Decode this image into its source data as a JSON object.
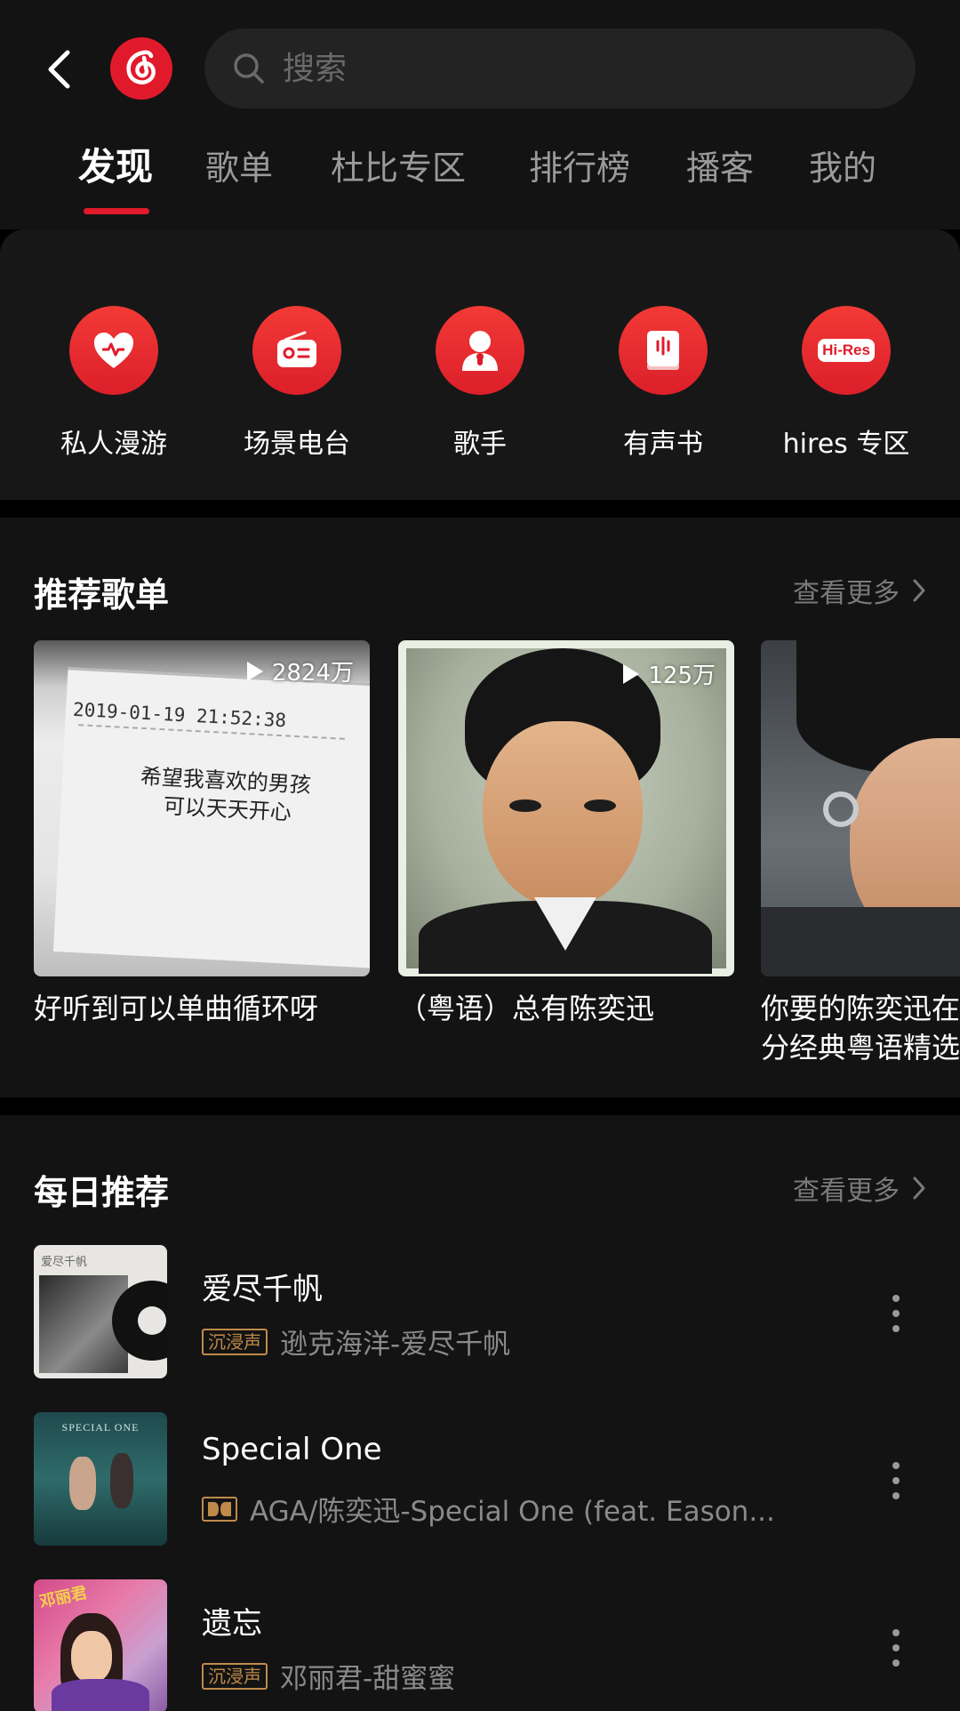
{
  "header": {
    "search_placeholder": "搜索",
    "tabs": [
      "发现",
      "歌单",
      "杜比专区",
      "排行榜",
      "播客",
      "我的"
    ]
  },
  "quick_entries": [
    {
      "label": "私人漫游",
      "icon": "heart-icon"
    },
    {
      "label": "场景电台",
      "icon": "radio-icon"
    },
    {
      "label": "歌手",
      "icon": "singer-icon"
    },
    {
      "label": "有声书",
      "icon": "audiobook-icon"
    },
    {
      "label": "hires 专区",
      "icon": "hires-icon",
      "icon_text": "Hi-Res"
    }
  ],
  "recommended_playlists": {
    "title": "推荐歌单",
    "see_more": "查看更多",
    "items": [
      {
        "title": "好听到可以单曲循环呀",
        "plays": "2824万",
        "cover_text_date": "2019-01-19 21:52:38",
        "cover_text_line1": "希望我喜欢的男孩",
        "cover_text_line2": "可以天天开心"
      },
      {
        "title": "（粤语）总有陈奕迅",
        "plays": "125万"
      },
      {
        "title": "你要的陈奕迅在这里！百分经典粤语精选"
      }
    ]
  },
  "daily": {
    "title": "每日推荐",
    "see_more": "查看更多",
    "songs": [
      {
        "title": "爱尽千帆",
        "badge": "沉浸声",
        "subtitle": "逊克海洋-爱尽千帆",
        "cover_title": "爱尽千帆"
      },
      {
        "title": "Special One",
        "badge": "dolby",
        "subtitle": "AGA/陈奕迅-Special One (feat. Eason...",
        "cover_title": "SPECIAL ONE"
      },
      {
        "title": "遗忘",
        "badge": "沉浸声",
        "subtitle": "邓丽君-甜蜜蜜",
        "cover_title": "邓丽君"
      }
    ]
  },
  "colors": {
    "accent": "#e11a2b",
    "background": "#131313",
    "badge": "#c08a4a"
  }
}
